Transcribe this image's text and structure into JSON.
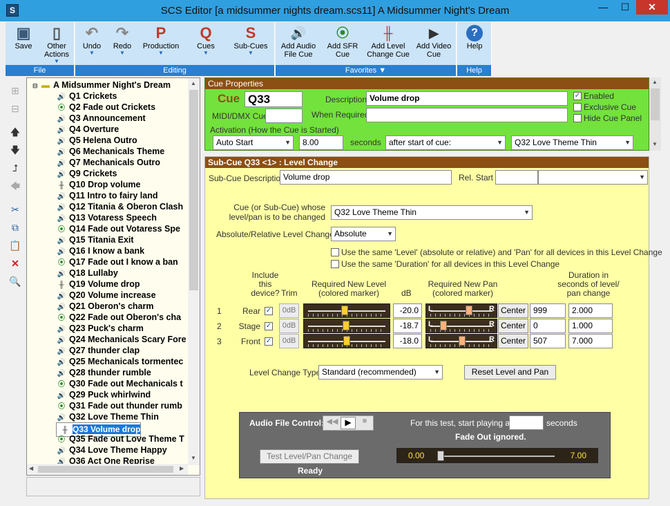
{
  "window": {
    "title": "SCS Editor  [a midsummer nights dream.scs11]  A Midsummer Night's Dream",
    "close": "✕",
    "minimize": "—",
    "maximize": "☐",
    "app_icon": "S"
  },
  "ribbon": {
    "file": {
      "label": "File",
      "save": "Save",
      "other_actions_1": "Other",
      "other_actions_2": "Actions"
    },
    "editing": {
      "label": "Editing",
      "undo": "Undo",
      "redo": "Redo",
      "production": "Production",
      "cues": "Cues",
      "subcues": "Sub-Cues",
      "prod_icon": "P",
      "cues_icon": "Q",
      "sub_icon": "S"
    },
    "favorites": {
      "label": "Favorites ▼",
      "add_audio_1": "Add Audio",
      "add_audio_2": "File Cue",
      "add_sfr_1": "Add SFR",
      "add_sfr_2": "Cue",
      "add_level_1": "Add Level",
      "add_level_2": "Change Cue",
      "add_video_1": "Add Video",
      "add_video_2": "Cue"
    },
    "help": {
      "label": "Help",
      "help": "Help"
    }
  },
  "tree": {
    "root": "A Midsummer Night's Dream",
    "items": [
      {
        "label": "Q1 Crickets",
        "kind": "audio"
      },
      {
        "label": "Q2 Fade out Crickets",
        "kind": "sfr"
      },
      {
        "label": "Q3 Announcement",
        "kind": "audio"
      },
      {
        "label": "Q4 Overture",
        "kind": "audio"
      },
      {
        "label": "Q5 Helena Outro",
        "kind": "audio"
      },
      {
        "label": "Q6 Mechanicals Theme",
        "kind": "audio"
      },
      {
        "label": "Q7 Mechanicals Outro",
        "kind": "audio"
      },
      {
        "label": "Q9 Crickets",
        "kind": "audio"
      },
      {
        "label": "Q10 Drop volume",
        "kind": "level"
      },
      {
        "label": "Q11 Intro to fairy land",
        "kind": "audio"
      },
      {
        "label": "Q12 Titania & Oberon Clash",
        "kind": "audio"
      },
      {
        "label": "Q13 Votaress Speech",
        "kind": "audio"
      },
      {
        "label": "Q14 Fade out Votaress Spe",
        "kind": "sfr"
      },
      {
        "label": "Q15 Titania Exit",
        "kind": "audio"
      },
      {
        "label": "Q16 I know a bank",
        "kind": "audio"
      },
      {
        "label": "Q17 Fade out I know a ban",
        "kind": "sfr"
      },
      {
        "label": "Q18 Lullaby",
        "kind": "audio"
      },
      {
        "label": "Q19 Volume drop",
        "kind": "level"
      },
      {
        "label": "Q20 Volume increase",
        "kind": "audio"
      },
      {
        "label": "Q21 Oberon's charm",
        "kind": "audio"
      },
      {
        "label": "Q22 Fade out Oberon's cha",
        "kind": "sfr"
      },
      {
        "label": "Q23 Puck's charm",
        "kind": "audio"
      },
      {
        "label": "Q24 Mechanicals Scary Fore",
        "kind": "audio"
      },
      {
        "label": "Q27 thunder clap",
        "kind": "audio"
      },
      {
        "label": "Q25 Mechanicals tormentec",
        "kind": "audio"
      },
      {
        "label": "Q28 thunder rumble",
        "kind": "audio"
      },
      {
        "label": "Q30 Fade out Mechanicals t",
        "kind": "sfr"
      },
      {
        "label": "Q29 Puck whirlwind",
        "kind": "audio"
      },
      {
        "label": "Q31 Fade out thunder rumb",
        "kind": "sfr"
      },
      {
        "label": "Q32 Love Theme Thin",
        "kind": "audio"
      },
      {
        "label": "Q33 Volume drop",
        "kind": "level",
        "selected": true
      },
      {
        "label": "Q35 Fade out Love Theme T",
        "kind": "sfr"
      },
      {
        "label": "Q34 Love Theme Happy",
        "kind": "audio"
      },
      {
        "label": "Q36 Act One Reprise",
        "kind": "audio"
      }
    ]
  },
  "cue_properties": {
    "header": "Cue Properties",
    "cue_label": "Cue",
    "cue_value": "Q33",
    "description_label": "Description",
    "description_value": "Volume drop",
    "midi_label": "MIDI/DMX Cue",
    "midi_value": "",
    "when_required_label": "When Required",
    "when_required_value": "",
    "activation_label": "Activation (How the Cue is Started)",
    "activation_value": "Auto Start",
    "seconds_value": "8.00",
    "seconds_label": "seconds",
    "after_start_value": "after start of cue:",
    "after_cue_value": "Q32  Love Theme Thin",
    "enabled": "Enabled",
    "exclusive": "Exclusive Cue",
    "hide": "Hide Cue Panel"
  },
  "subcue": {
    "header": "Sub-Cue Q33 <1> : Level Change",
    "desc_label": "Sub-Cue Description",
    "desc_value": "Volume drop",
    "rel_start_label": "Rel. Start",
    "target_label_1": "Cue (or Sub-Cue) whose",
    "target_label_2": "level/pan is to be changed",
    "target_value": "Q32  Love Theme Thin",
    "absrel_label": "Absolute/Relative Level Change?",
    "absrel_value": "Absolute",
    "same_level": "Use the same 'Level' (absolute or relative) and 'Pan' for all devices in this Level Change",
    "same_duration": "Use the same 'Duration' for all devices in this Level Change",
    "col_include_1": "Include",
    "col_include_2": "this",
    "col_include_3": "device?",
    "col_trim": "Trim",
    "col_level_1": "Required New Level",
    "col_level_2": "(colored marker)",
    "col_db": "dB",
    "col_pan_1": "Required New Pan",
    "col_pan_2": "(colored marker)",
    "col_dur_1": "Duration in",
    "col_dur_2": "seconds of level/",
    "col_dur_3": "pan change",
    "devices": [
      {
        "num": "1",
        "name": "Rear",
        "trim": "0dB",
        "db": "-20.0",
        "level": 0.46,
        "pan": 0.64,
        "center": "Center",
        "pan_value": "999",
        "duration": "2.000"
      },
      {
        "num": "2",
        "name": "Stage",
        "trim": "0dB",
        "db": "-18.7",
        "level": 0.48,
        "pan": 0.12,
        "center": "Center",
        "pan_value": "0",
        "duration": "1.000"
      },
      {
        "num": "3",
        "name": "Front",
        "trim": "0dB",
        "db": "-18.0",
        "level": 0.49,
        "pan": 0.5,
        "center": "Center",
        "pan_value": "507",
        "duration": "7.000"
      }
    ],
    "pan_left": "L",
    "pan_right": "R",
    "level_change_type_label": "Level Change Type",
    "level_change_type_value": "Standard (recommended)",
    "reset_button": "Reset Level and Pan"
  },
  "audio_control": {
    "label": "Audio File Control:",
    "test_prefix": "For this test, start playing at",
    "test_suffix": "seconds",
    "start_value": "",
    "fade_note": "Fade Out ignored.",
    "test_button": "Test Level/Pan Change",
    "status": "Ready",
    "pos_start": "0.00",
    "pos_end": "7.00",
    "pos_fraction": 0.0
  },
  "colors": {
    "title_bg": "#2f9fe0",
    "cue_panel": "#73e23c",
    "subcue_panel": "#ffffa6",
    "header_brown": "#8c4f14",
    "selection": "#1e78d8"
  }
}
